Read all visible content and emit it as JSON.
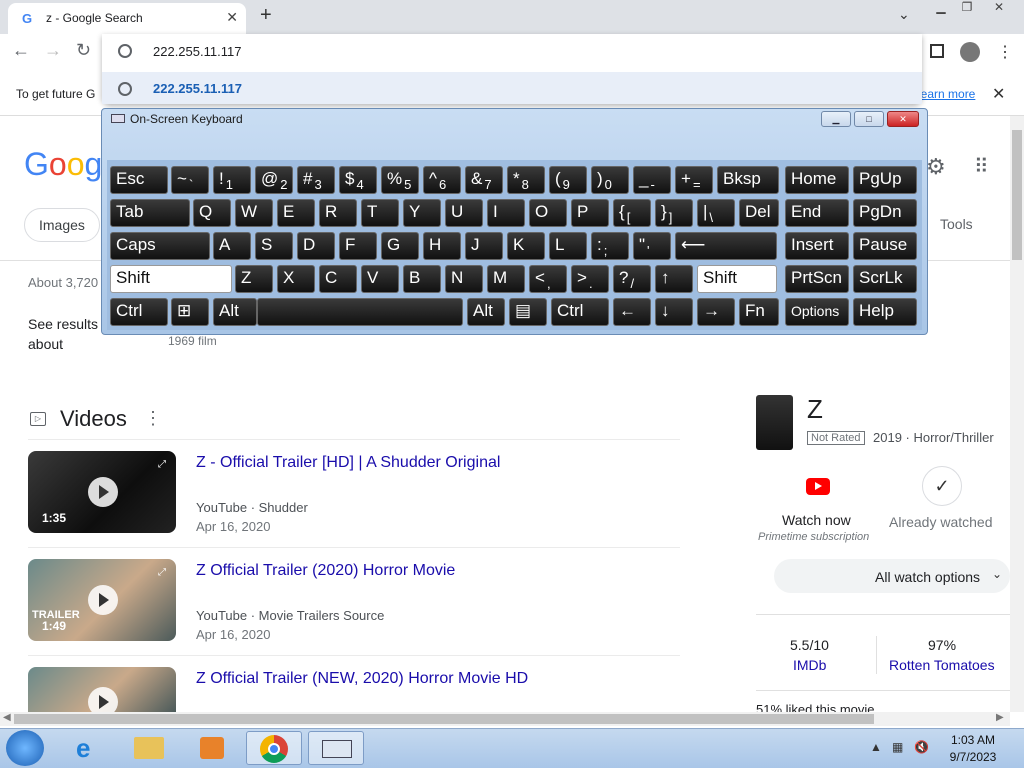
{
  "browser": {
    "tab_title": "z - Google Search",
    "address": "222.255.11.117",
    "suggestion": "222.255.11.117"
  },
  "infobar": {
    "text": "To get future G",
    "link": "learn more"
  },
  "google": {
    "chip_images": "Images",
    "tools": "Tools",
    "results_count": "About 3,720",
    "see_results": "See results about",
    "film_pill": "1969 film",
    "videos_heading": "Videos",
    "videos": [
      {
        "title": "Z - Official Trailer [HD] | A Shudder Original",
        "source": "YouTube · Shudder",
        "date": "Apr 16, 2020",
        "duration": "1:35"
      },
      {
        "title": "Z Official Trailer (2020) Horror Movie",
        "source": "YouTube · Movie Trailers Source",
        "date": "Apr 16, 2020",
        "duration": "1:49",
        "badge": "TRAILER"
      },
      {
        "title": "Z Official Trailer (NEW, 2020) Horror Movie HD",
        "source": "",
        "date": "",
        "duration": ""
      }
    ]
  },
  "knowledge_panel": {
    "title": "Z",
    "rating": "Not Rated",
    "meta": "2019 · Horror/Thriller",
    "watch_now": "Watch now",
    "watch_sub": "Primetime subscription",
    "already_watched": "Already watched",
    "all_watch": "All watch options",
    "imdb_score": "5.5/10",
    "imdb_label": "IMDb",
    "rt_score": "97%",
    "rt_label": "Rotten Tomatoes",
    "liked": "51% liked this movie"
  },
  "osk": {
    "title": "On-Screen Keyboard",
    "rows": [
      [
        {
          "m": "Esc"
        },
        {
          "m": "~",
          "s": "`"
        },
        {
          "m": "!",
          "s": "1"
        },
        {
          "m": "@",
          "s": "2"
        },
        {
          "m": "#",
          "s": "3"
        },
        {
          "m": "$",
          "s": "4"
        },
        {
          "m": "%",
          "s": "5"
        },
        {
          "m": "^",
          "s": "6"
        },
        {
          "m": "&",
          "s": "7"
        },
        {
          "m": "*",
          "s": "8"
        },
        {
          "m": "(",
          "s": "9"
        },
        {
          "m": ")",
          "s": "0"
        },
        {
          "m": "_",
          "s": "-"
        },
        {
          "m": "+",
          "s": "="
        },
        {
          "m": "Bksp"
        },
        {
          "m": "Home"
        },
        {
          "m": "PgUp"
        }
      ],
      [
        {
          "m": "Tab"
        },
        {
          "m": "Q"
        },
        {
          "m": "W"
        },
        {
          "m": "E"
        },
        {
          "m": "R"
        },
        {
          "m": "T"
        },
        {
          "m": "Y"
        },
        {
          "m": "U"
        },
        {
          "m": "I"
        },
        {
          "m": "O"
        },
        {
          "m": "P"
        },
        {
          "m": "{",
          "s": "["
        },
        {
          "m": "}",
          "s": "]"
        },
        {
          "m": "|",
          "s": "\\"
        },
        {
          "m": "Del"
        },
        {
          "m": "End"
        },
        {
          "m": "PgDn"
        }
      ],
      [
        {
          "m": "Caps"
        },
        {
          "m": "A"
        },
        {
          "m": "S"
        },
        {
          "m": "D"
        },
        {
          "m": "F"
        },
        {
          "m": "G"
        },
        {
          "m": "H"
        },
        {
          "m": "J"
        },
        {
          "m": "K"
        },
        {
          "m": "L"
        },
        {
          "m": ":",
          "s": ";"
        },
        {
          "m": "\"",
          "s": "'"
        },
        {
          "m": "⟵"
        },
        {
          "m": "Insert"
        },
        {
          "m": "Pause"
        }
      ],
      [
        {
          "m": "Shift",
          "w": 1
        },
        {
          "m": "Z"
        },
        {
          "m": "X"
        },
        {
          "m": "C"
        },
        {
          "m": "V"
        },
        {
          "m": "B"
        },
        {
          "m": "N"
        },
        {
          "m": "M"
        },
        {
          "m": "<",
          "s": ","
        },
        {
          "m": ">",
          "s": "."
        },
        {
          "m": "?",
          "s": "/"
        },
        {
          "m": "↑"
        },
        {
          "m": "Shift",
          "w": 1
        },
        {
          "m": "PrtScn"
        },
        {
          "m": "ScrLk"
        }
      ],
      [
        {
          "m": "Ctrl"
        },
        {
          "m": "⊞"
        },
        {
          "m": "Alt"
        },
        {
          "m": ""
        },
        {
          "m": "Alt"
        },
        {
          "m": "▤"
        },
        {
          "m": "Ctrl"
        },
        {
          "m": "←"
        },
        {
          "m": "↓"
        },
        {
          "m": "→"
        },
        {
          "m": "Fn"
        },
        {
          "m": "Options"
        },
        {
          "m": "Help"
        }
      ]
    ]
  },
  "taskbar": {
    "time": "1:03 AM",
    "date": "9/7/2023"
  }
}
